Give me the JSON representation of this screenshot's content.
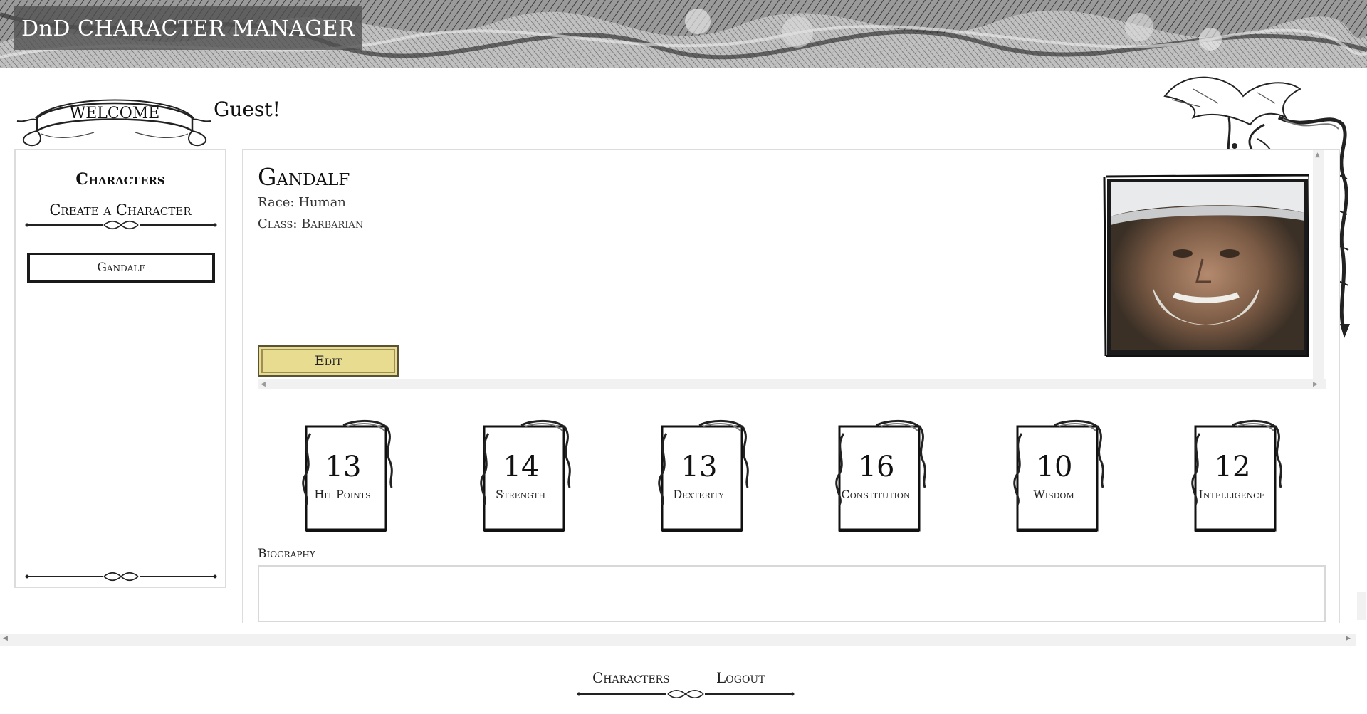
{
  "header": {
    "app_title": "DnD CHARACTER MANAGER"
  },
  "welcome": {
    "ribbon_text": "WELCOME",
    "user": "Guest!"
  },
  "sidebar": {
    "title": "Characters",
    "create_label": "Create a Character",
    "characters": [
      "Gandalf"
    ]
  },
  "character": {
    "name": "Gandalf",
    "race_line": "Race: Human",
    "class_line": "Class: Barbarian",
    "edit_label": "Edit",
    "stats": [
      {
        "value": "13",
        "label": "Hit Points"
      },
      {
        "value": "14",
        "label": "Strength"
      },
      {
        "value": "13",
        "label": "Dexterity"
      },
      {
        "value": "16",
        "label": "Constitution"
      },
      {
        "value": "10",
        "label": "Wisdom"
      },
      {
        "value": "12",
        "label": "Intelligence"
      }
    ],
    "biography_label": "Biography",
    "biography_value": ""
  },
  "footer": {
    "nav": [
      "Characters",
      "Logout"
    ]
  },
  "colors": {
    "edit_button_bg": "#e8dc91",
    "title_box_bg": "#505050",
    "border_gray": "#dcdcdc"
  },
  "icons": {
    "banner": "forest-engraving-banner",
    "ribbon": "welcome-scroll-ribbon",
    "dragon": "dragon-ornament-icon",
    "flourish": "divider-flourish-icon",
    "stat_frame": "scroll-frame-icon"
  }
}
